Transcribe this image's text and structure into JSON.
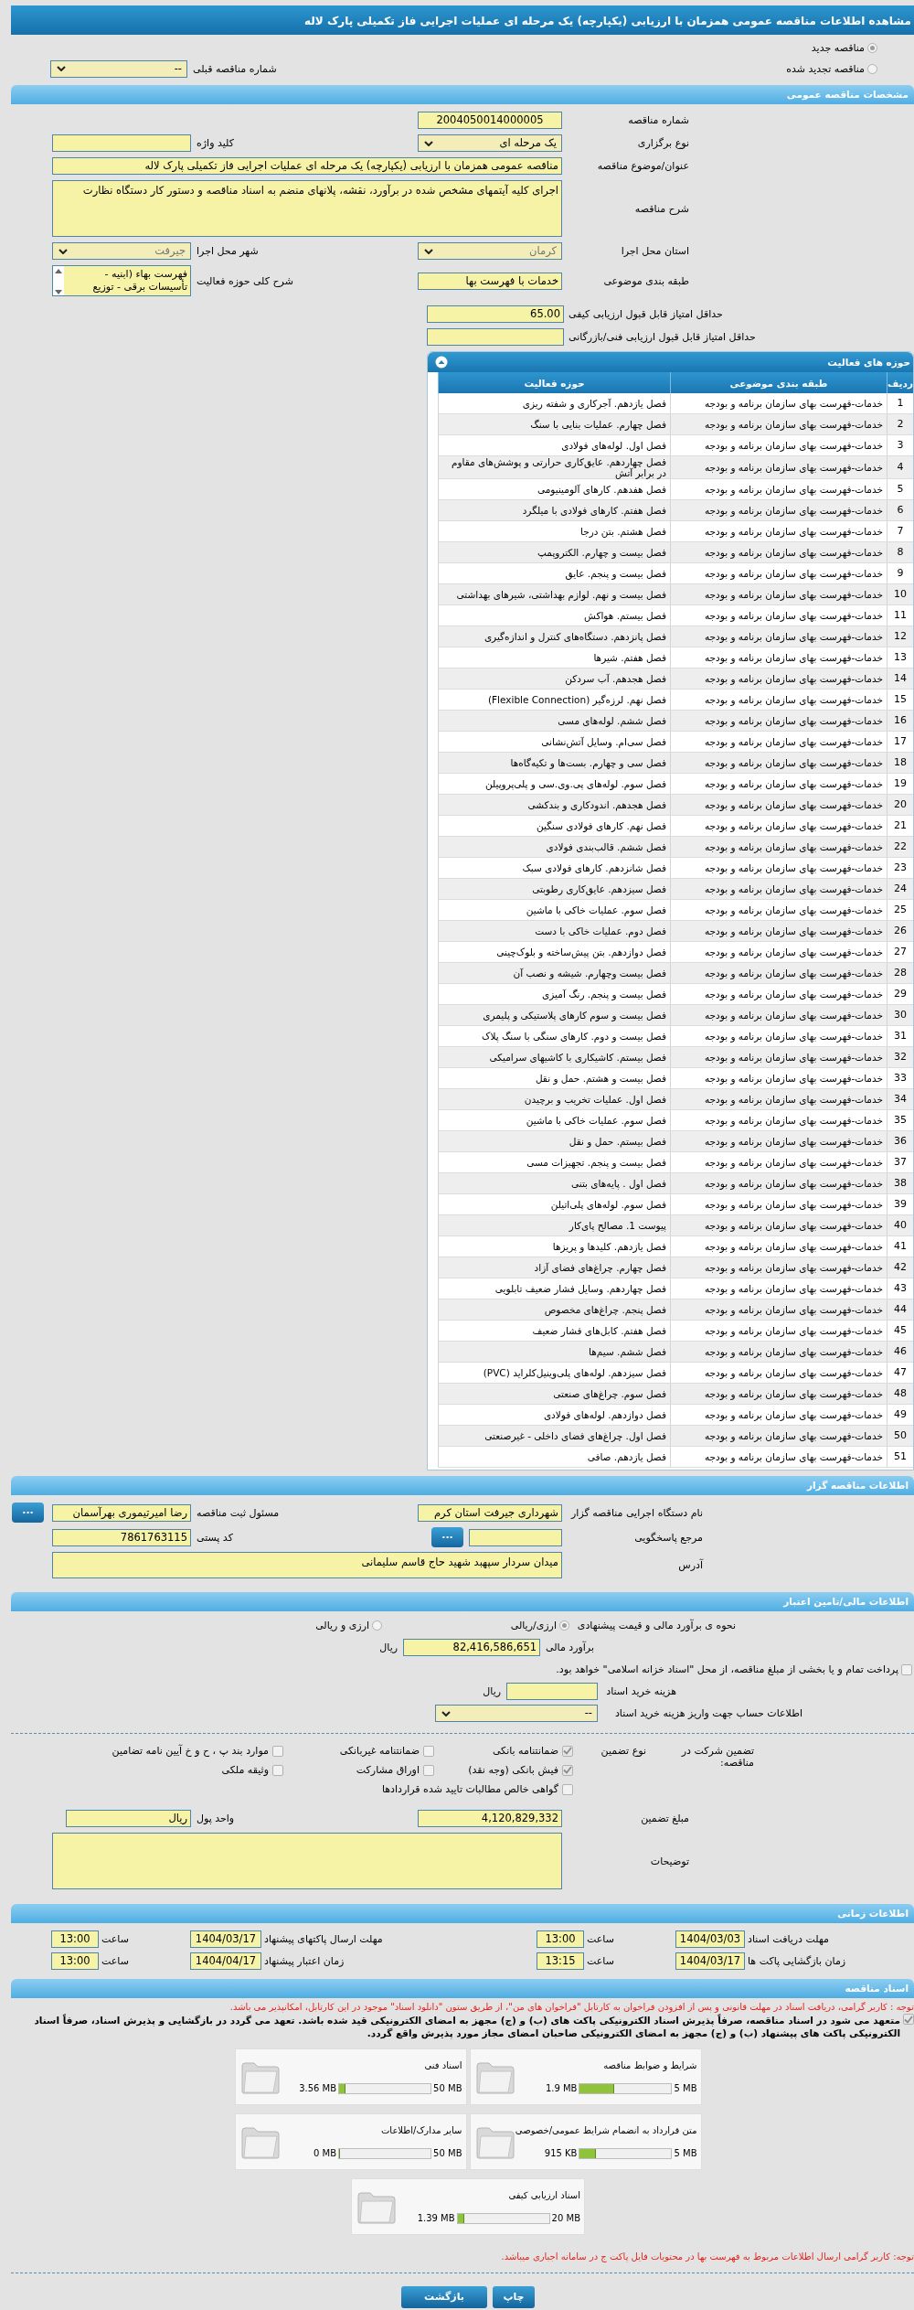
{
  "title": "مشاهده اطلاعات مناقصه عمومی همزمان با ارزیابی (یکپارچه) یک مرحله ای عملیات اجرایی فاز تکمیلی پارک لاله",
  "tender_type": [
    {
      "label": "مناقصه جدید",
      "selected": true
    },
    {
      "label": "مناقصه تجدید شده",
      "selected": false
    }
  ],
  "previous_tender": {
    "label": "شماره مناقصه قبلی",
    "value": "--"
  },
  "general": {
    "heading": "مشخصات مناقصه عمومی",
    "tender_number": {
      "label": "شماره مناقصه",
      "value": "2004050014000005"
    },
    "holding_type": {
      "label": "نوع برگزاری",
      "value": "یک مرحله ای"
    },
    "keyword": {
      "label": "کلید واژه"
    },
    "subject": {
      "label": "عنوان/موضوع مناقصه",
      "value": "مناقصه عمومی همزمان با ارزیابی (یکپارچه) یک مرحله ای عملیات اجرایی فاز تکمیلی پارک لاله"
    },
    "description": {
      "label": "شرح مناقصه",
      "value": "اجرای کلیه آیتمهای مشخص شده در برآورد، نقشه، پلانهای منضم به اسناد مناقصه و دستور کار دستگاه نظارت"
    },
    "province": {
      "label": "استان محل اجرا",
      "value": "کرمان",
      "disabled": true
    },
    "city": {
      "label": "شهر محل اجرا",
      "value": "جیرفت",
      "disabled": true
    },
    "classification": {
      "label": "طبقه بندی موضوعی",
      "value": "خدمات با فهرست بها"
    },
    "activity_summary": {
      "label": "شرح کلی حوزه فعالیت",
      "lines": [
        "فهرست بهاء (ابنیه -",
        "تأسیسات برقی - توزیع"
      ]
    },
    "min_quality_score": {
      "label": "حداقل امتیاز قابل قبول ارزیابی کیفی",
      "value": "65.00"
    },
    "min_technical_score": {
      "label": "حداقل امتیاز قابل قبول ارزیابی فنی/بازرگانی"
    }
  },
  "activities": {
    "title": "حوزه های فعالیت",
    "columns": [
      "ردیف",
      "طبقه بندی موضوعی",
      "حوزه فعالیت"
    ],
    "rows": [
      {
        "number": "1",
        "classification": "خدمات-فهرست بهای سازمان برنامه و بودجه",
        "activity": "فصل یازدهم. آجرکاری و شفته ریزی"
      },
      {
        "number": "2",
        "classification": "خدمات-فهرست بهای سازمان برنامه و بودجه",
        "activity": "فصل چهارم. عملیات بنایی با سنگ"
      },
      {
        "number": "3",
        "classification": "خدمات-فهرست بهای سازمان برنامه و بودجه",
        "activity": "فصل اول. لوله‌های فولادی"
      },
      {
        "number": "4",
        "classification": "خدمات-فهرست بهای سازمان برنامه و بودجه",
        "activity": "فصل چهاردهم. عایق‌کاری حرارتی و پوشش‌های مقاوم در برابر آتش"
      },
      {
        "number": "5",
        "classification": "خدمات-فهرست بهای سازمان برنامه و بودجه",
        "activity": "فصل هفدهم. کارهای آلومینیومی"
      },
      {
        "number": "6",
        "classification": "خدمات-فهرست بهای سازمان برنامه و بودجه",
        "activity": "فصل هفتم. کارهای فولادی با میلگرد"
      },
      {
        "number": "7",
        "classification": "خدمات-فهرست بهای سازمان برنامه و بودجه",
        "activity": "فصل هشتم. بتن درجا"
      },
      {
        "number": "8",
        "classification": "خدمات-فهرست بهای سازمان برنامه و بودجه",
        "activity": "فصل بیست و چهارم. الکتروپمپ"
      },
      {
        "number": "9",
        "classification": "خدمات-فهرست بهای سازمان برنامه و بودجه",
        "activity": "فصل بیست و پنجم. عایق"
      },
      {
        "number": "10",
        "classification": "خدمات-فهرست بهای سازمان برنامه و بودجه",
        "activity": "فصل بیست و نهم. لوازم بهداشتی، شیرهای بهداشتی"
      },
      {
        "number": "11",
        "classification": "خدمات-فهرست بهای سازمان برنامه و بودجه",
        "activity": "فصل بیستم. هواکش"
      },
      {
        "number": "12",
        "classification": "خدمات-فهرست بهای سازمان برنامه و بودجه",
        "activity": "فصل پانزدهم. دستگاه‌های کنترل و اندازه‌گیری"
      },
      {
        "number": "13",
        "classification": "خدمات-فهرست بهای سازمان برنامه و بودجه",
        "activity": "فصل هفتم. شیرها"
      },
      {
        "number": "14",
        "classification": "خدمات-فهرست بهای سازمان برنامه و بودجه",
        "activity": "فصل هجدهم. آب سردکن"
      },
      {
        "number": "15",
        "classification": "خدمات-فهرست بهای سازمان برنامه و بودجه",
        "activity": "فصل نهم. لرزه‌گیر (Flexible Connection)"
      },
      {
        "number": "16",
        "classification": "خدمات-فهرست بهای سازمان برنامه و بودجه",
        "activity": "فصل ششم. لوله‌های مسی"
      },
      {
        "number": "17",
        "classification": "خدمات-فهرست بهای سازمان برنامه و بودجه",
        "activity": "فصل سی‌ام. وسایل آتش‌نشانی"
      },
      {
        "number": "18",
        "classification": "خدمات-فهرست بهای سازمان برنامه و بودجه",
        "activity": "فصل سی و چهارم. بست‌ها و تکیه‌گاه‌ها"
      },
      {
        "number": "19",
        "classification": "خدمات-فهرست بهای سازمان برنامه و بودجه",
        "activity": "فصل سوم. لوله‌های پی.وی.سی و پلی‌پروپیلن"
      },
      {
        "number": "20",
        "classification": "خدمات-فهرست بهای سازمان برنامه و بودجه",
        "activity": "فصل هجدهم. اندودکاری و بندکشی"
      },
      {
        "number": "21",
        "classification": "خدمات-فهرست بهای سازمان برنامه و بودجه",
        "activity": "فصل نهم. کارهای فولادی سنگین"
      },
      {
        "number": "22",
        "classification": "خدمات-فهرست بهای سازمان برنامه و بودجه",
        "activity": "فصل ششم. قالب‌بندی فولادی"
      },
      {
        "number": "23",
        "classification": "خدمات-فهرست بهای سازمان برنامه و بودجه",
        "activity": "فصل شانزدهم. کارهای فولادی سبک"
      },
      {
        "number": "24",
        "classification": "خدمات-فهرست بهای سازمان برنامه و بودجه",
        "activity": "فصل سیزدهم. عایق‌کاری رطوبتی"
      },
      {
        "number": "25",
        "classification": "خدمات-فهرست بهای سازمان برنامه و بودجه",
        "activity": "فصل سوم. عملیات خاکی با ماشین"
      },
      {
        "number": "26",
        "classification": "خدمات-فهرست بهای سازمان برنامه و بودجه",
        "activity": "فصل دوم. عملیات خاکی با دست"
      },
      {
        "number": "27",
        "classification": "خدمات-فهرست بهای سازمان برنامه و بودجه",
        "activity": "فصل دوازدهم. بتن پیش‌ساخته و بلوک‌چینی"
      },
      {
        "number": "28",
        "classification": "خدمات-فهرست بهای سازمان برنامه و بودجه",
        "activity": "فصل بیست وچهارم. شیشه و نصب آن"
      },
      {
        "number": "29",
        "classification": "خدمات-فهرست بهای سازمان برنامه و بودجه",
        "activity": "فصل بیست و پنجم. رنگ آمیزی"
      },
      {
        "number": "30",
        "classification": "خدمات-فهرست بهای سازمان برنامه و بودجه",
        "activity": "فصل بیست و سوم کارهای پلاستیکی و پلیمری"
      },
      {
        "number": "31",
        "classification": "خدمات-فهرست بهای سازمان برنامه و بودجه",
        "activity": "فصل بیست و دوم. کارهای سنگی با سنگ پلاک"
      },
      {
        "number": "32",
        "classification": "خدمات-فهرست بهای سازمان برنامه و بودجه",
        "activity": "فصل بیستم. کاشیکاری با کاشیهای سرامیکی"
      },
      {
        "number": "33",
        "classification": "خدمات-فهرست بهای سازمان برنامه و بودجه",
        "activity": "فصل بیست و هشتم. حمل و نقل"
      },
      {
        "number": "34",
        "classification": "خدمات-فهرست بهای سازمان برنامه و بودجه",
        "activity": "فصل اول. عملیات تخریب و برچیدن"
      },
      {
        "number": "35",
        "classification": "خدمات-فهرست بهای سازمان برنامه و بودجه",
        "activity": "فصل سوم. عملیات خاکی با ماشین"
      },
      {
        "number": "36",
        "classification": "خدمات-فهرست بهای سازمان برنامه و بودجه",
        "activity": "فصل بیستم. حمل و نقل"
      },
      {
        "number": "37",
        "classification": "خدمات-فهرست بهای سازمان برنامه و بودجه",
        "activity": "فصل بیست و پنجم. تجهیزات مسی"
      },
      {
        "number": "38",
        "classification": "خدمات-فهرست بهای سازمان برنامه و بودجه",
        "activity": "فصل اول . پایه‌های بتنی"
      },
      {
        "number": "39",
        "classification": "خدمات-فهرست بهای سازمان برنامه و بودجه",
        "activity": "فصل سوم. لوله‌های پلی‌اتیلن"
      },
      {
        "number": "40",
        "classification": "خدمات-فهرست بهای سازمان برنامه و بودجه",
        "activity": "پیوست 1. مصالح پای‌کار"
      },
      {
        "number": "41",
        "classification": "خدمات-فهرست بهای سازمان برنامه و بودجه",
        "activity": "فصل یازدهم. کلیدها و پریزها"
      },
      {
        "number": "42",
        "classification": "خدمات-فهرست بهای سازمان برنامه و بودجه",
        "activity": "فصل چهارم. چراغ‌های فضای آزاد"
      },
      {
        "number": "43",
        "classification": "خدمات-فهرست بهای سازمان برنامه و بودجه",
        "activity": "فصل چهاردهم. وسایل فشار ضعیف تابلویی"
      },
      {
        "number": "44",
        "classification": "خدمات-فهرست بهای سازمان برنامه و بودجه",
        "activity": "فصل پنجم. چراغ‌های مخصوص"
      },
      {
        "number": "45",
        "classification": "خدمات-فهرست بهای سازمان برنامه و بودجه",
        "activity": "فصل هفتم. کابل‌های فشار ضعیف"
      },
      {
        "number": "46",
        "classification": "خدمات-فهرست بهای سازمان برنامه و بودجه",
        "activity": "فصل ششم. سیم‌ها"
      },
      {
        "number": "47",
        "classification": "خدمات-فهرست بهای سازمان برنامه و بودجه",
        "activity": "فصل سیزدهم. لوله‌های پلی‌وینیل‌کلراید (PVC)"
      },
      {
        "number": "48",
        "classification": "خدمات-فهرست بهای سازمان برنامه و بودجه",
        "activity": "فصل سوم. چراغ‌های صنعتی"
      },
      {
        "number": "49",
        "classification": "خدمات-فهرست بهای سازمان برنامه و بودجه",
        "activity": "فصل دوازدهم. لوله‌های فولادی"
      },
      {
        "number": "50",
        "classification": "خدمات-فهرست بهای سازمان برنامه و بودجه",
        "activity": "فصل اول. چراغ‌های فضای داخلی - غیرصنعتی"
      },
      {
        "number": "51",
        "classification": "خدمات-فهرست بهای سازمان برنامه و بودجه",
        "activity": "فصل یازدهم. صافی"
      }
    ]
  },
  "organizer": {
    "heading": "اطلاعات مناقصه گزار",
    "agency": {
      "label": "نام دستگاه اجرایی مناقصه گزار",
      "value": "شهرداری جیرفت استان کرم"
    },
    "registrar": {
      "label": "مسئول ثبت مناقصه",
      "value": "رضا امیرتیموری بهرآسمان",
      "button": "..."
    },
    "reference": {
      "label": "مرجع پاسخگویی",
      "button": "..."
    },
    "postal_code": {
      "label": "کد پستی",
      "value": "7861763115"
    },
    "address": {
      "label": "آدرس",
      "value": "میدان سردار سپهبد شهید حاج قاسم سلیمانی"
    }
  },
  "financial": {
    "heading": "اطلاعات مالی/تامین اعتبار",
    "estimate_method": {
      "label": "نحوه ی برآورد مالی و قیمت پیشنهادی",
      "options": [
        {
          "label": "ارزی/ریالی",
          "selected": true
        },
        {
          "label": "ارزی و ریالی",
          "selected": false
        }
      ]
    },
    "estimate": {
      "label": "برآورد مالی",
      "value": "82,416,586,651",
      "unit": "ریال"
    },
    "treasury": {
      "label": "پرداخت تمام و یا بخشی از مبلغ مناقصه، از محل \"اسناد خزانه اسلامی\" خواهد بود.",
      "checked": false
    },
    "document_fee": {
      "label": "هزینه خرید اسناد",
      "unit": "ریال"
    },
    "account": {
      "label": "اطلاعات حساب جهت واریز هزینه خرید اسناد",
      "value": "--"
    },
    "guarantee_label": "تضمین شرکت در مناقصه:",
    "guarantee_type_label": "نوع تضمین",
    "guarantees": [
      {
        "label": "ضمانتنامه بانکی",
        "checked": true
      },
      {
        "label": "ضمانتنامه غیربانکی",
        "checked": false
      },
      {
        "label": "موارد بند پ ، ح و خ آیین نامه تضامین",
        "checked": false
      },
      {
        "label": "فیش بانکی (وجه نقد)",
        "checked": true
      },
      {
        "label": "اوراق مشارکت",
        "checked": false
      },
      {
        "label": "وثیقه ملکی",
        "checked": false
      },
      {
        "label": "گواهی خالص مطالبات تایید شده قراردادها",
        "checked": false
      }
    ],
    "guarantee_amount": {
      "label": "مبلغ تضمین",
      "value": "4,120,829,332"
    },
    "currency": {
      "label": "واحد پول",
      "value": "ریال"
    },
    "notes": {
      "label": "توضیحات"
    }
  },
  "timing": {
    "heading": "اطلاعات زمانی",
    "rows": [
      [
        {
          "label": "مهلت دریافت اسناد",
          "date": "1404/03/03",
          "time_label": "ساعت",
          "time": "13:00"
        },
        {
          "label": "مهلت ارسال پاکتهای پیشنهاد",
          "date": "1404/03/17",
          "time_label": "ساعت",
          "time": "13:00"
        }
      ],
      [
        {
          "label": "زمان بازگشایی پاکت ها",
          "date": "1404/03/17",
          "time_label": "ساعت",
          "time": "13:15"
        },
        {
          "label": "زمان اعتبار پیشنهاد",
          "date": "1404/04/17",
          "time_label": "ساعت",
          "time": "13:00"
        }
      ]
    ]
  },
  "documents": {
    "heading": "اسناد مناقصه",
    "notice": "توجه : کاربر گرامی، دریافت اسناد در مهلت قانونی و پس از افزودن فراخوان به کارتابل \"فراخوان های من\"، از طریق ستون \"دانلود اسناد\" موجود در این کارتابل، امکانپذیر می باشد.",
    "commitment": {
      "checked": true,
      "text": "متعهد می شود در اسناد مناقصه، صرفاً پذیرش اسناد الکترونیکی پاکت های (ب) و (ج) مجهز به امضای الکترونیکی قید شده باشد. تعهد می گردد در بازگشایی و پذیرش اسناد، صرفاً اسناد الکترونیکی پاکت های پیشنهاد (ب) و (ج) مجهز به امضای الکترونیکی صاحبان امضای مجاز مورد پذیرش واقع گردد."
    },
    "files": [
      {
        "title": "شرایط و ضوابط مناقصه",
        "used": "1.9 MB",
        "max": "5 MB",
        "level": 0.38
      },
      {
        "title": "اسناد فنی",
        "used": "3.56 MB",
        "max": "50 MB",
        "level": 0.071
      },
      {
        "title": "متن قرارداد به انضمام شرایط عمومی/خصوصی",
        "used": "915 KB",
        "max": "5 MB",
        "level": 0.18
      },
      {
        "title": "سایر مدارک/اطلاعات",
        "used": "0 MB",
        "max": "50 MB",
        "level": 0
      },
      {
        "title": "اسناد ارزیابی کیفی",
        "used": "1.39 MB",
        "max": "20 MB",
        "level": 0.07
      }
    ],
    "footer_note": "توجه: کاربر گرامی ارسال اطلاعات مربوط به فهرست بها در محتویات فایل پاکت ج در سامانه اجباری میباشد."
  },
  "buttons": {
    "print": "چاپ",
    "back": "بازگشت"
  }
}
